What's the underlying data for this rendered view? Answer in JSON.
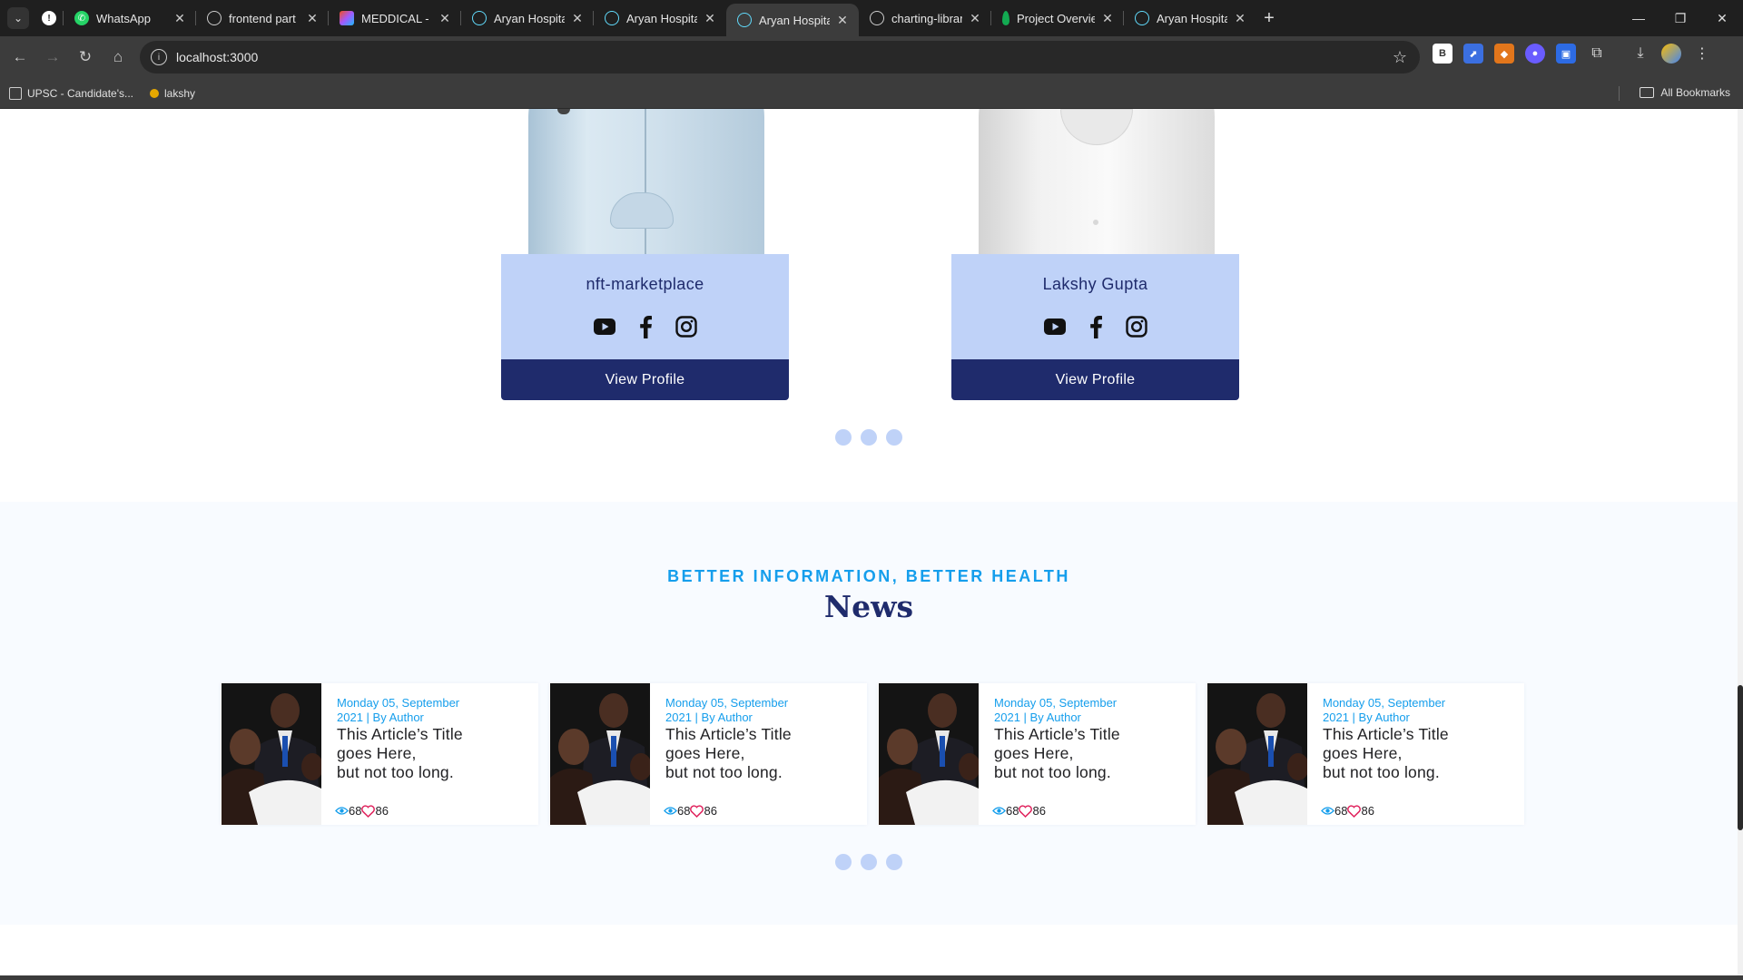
{
  "browser": {
    "tabs": [
      {
        "title": "WhatsApp",
        "icon": "whatsapp-icon",
        "color": "#25d366"
      },
      {
        "title": "frontend part by lak",
        "icon": "github-icon",
        "color": "#cccccc"
      },
      {
        "title": "MEDDICAL - Hospita",
        "icon": "figma-icon",
        "color": "#a259ff"
      },
      {
        "title": "Aryan Hospital",
        "icon": "react-icon",
        "color": "#61dafb"
      },
      {
        "title": "Aryan Hospital",
        "icon": "react-icon",
        "color": "#61dafb"
      },
      {
        "title": "Aryan Hospital",
        "icon": "react-icon",
        "color": "#61dafb",
        "active": true
      },
      {
        "title": "charting-library-tuto",
        "icon": "github-icon",
        "color": "#cccccc"
      },
      {
        "title": "Project Overview | C",
        "icon": "mongodb-icon",
        "color": "#13aa52"
      },
      {
        "title": "Aryan Hospital",
        "icon": "react-icon",
        "color": "#61dafb"
      }
    ],
    "url": "localhost:3000",
    "bookmarks": [
      {
        "label": "UPSC - Candidate's..."
      },
      {
        "label": "lakshy"
      }
    ],
    "all_bookmarks": "All Bookmarks"
  },
  "doctors": [
    {
      "name": "nft-marketplace",
      "button": "View Profile"
    },
    {
      "name": "Lakshy Gupta",
      "button": "View Profile"
    }
  ],
  "news": {
    "eyebrow": "BETTER INFORMATION, BETTER HEALTH",
    "title": "News",
    "articles": [
      {
        "date_line1": "Monday 05, September",
        "date_line2": "2021 | By Author",
        "title_line1": "This Article’s Title",
        "title_line2": "goes Here,",
        "title_line3": "but not too long.",
        "views": "68",
        "likes": "86"
      },
      {
        "date_line1": "Monday 05, September",
        "date_line2": "2021 | By Author",
        "title_line1": "This Article’s Title",
        "title_line2": "goes Here,",
        "title_line3": "but not too long.",
        "views": "68",
        "likes": "86"
      },
      {
        "date_line1": "Monday 05, September",
        "date_line2": "2021 | By Author",
        "title_line1": "This Article’s Title",
        "title_line2": "goes Here,",
        "title_line3": "but not too long.",
        "views": "68",
        "likes": "86"
      },
      {
        "date_line1": "Monday 05, September",
        "date_line2": "2021 | By Author",
        "title_line1": "This Article’s Title",
        "title_line2": "goes Here,",
        "title_line3": "but not too long.",
        "views": "68",
        "likes": "86"
      }
    ]
  },
  "colors": {
    "primary": "#1f2b6c",
    "accent": "#159eec",
    "light_blue": "#bfd2f8",
    "heart": "#e0245e"
  }
}
